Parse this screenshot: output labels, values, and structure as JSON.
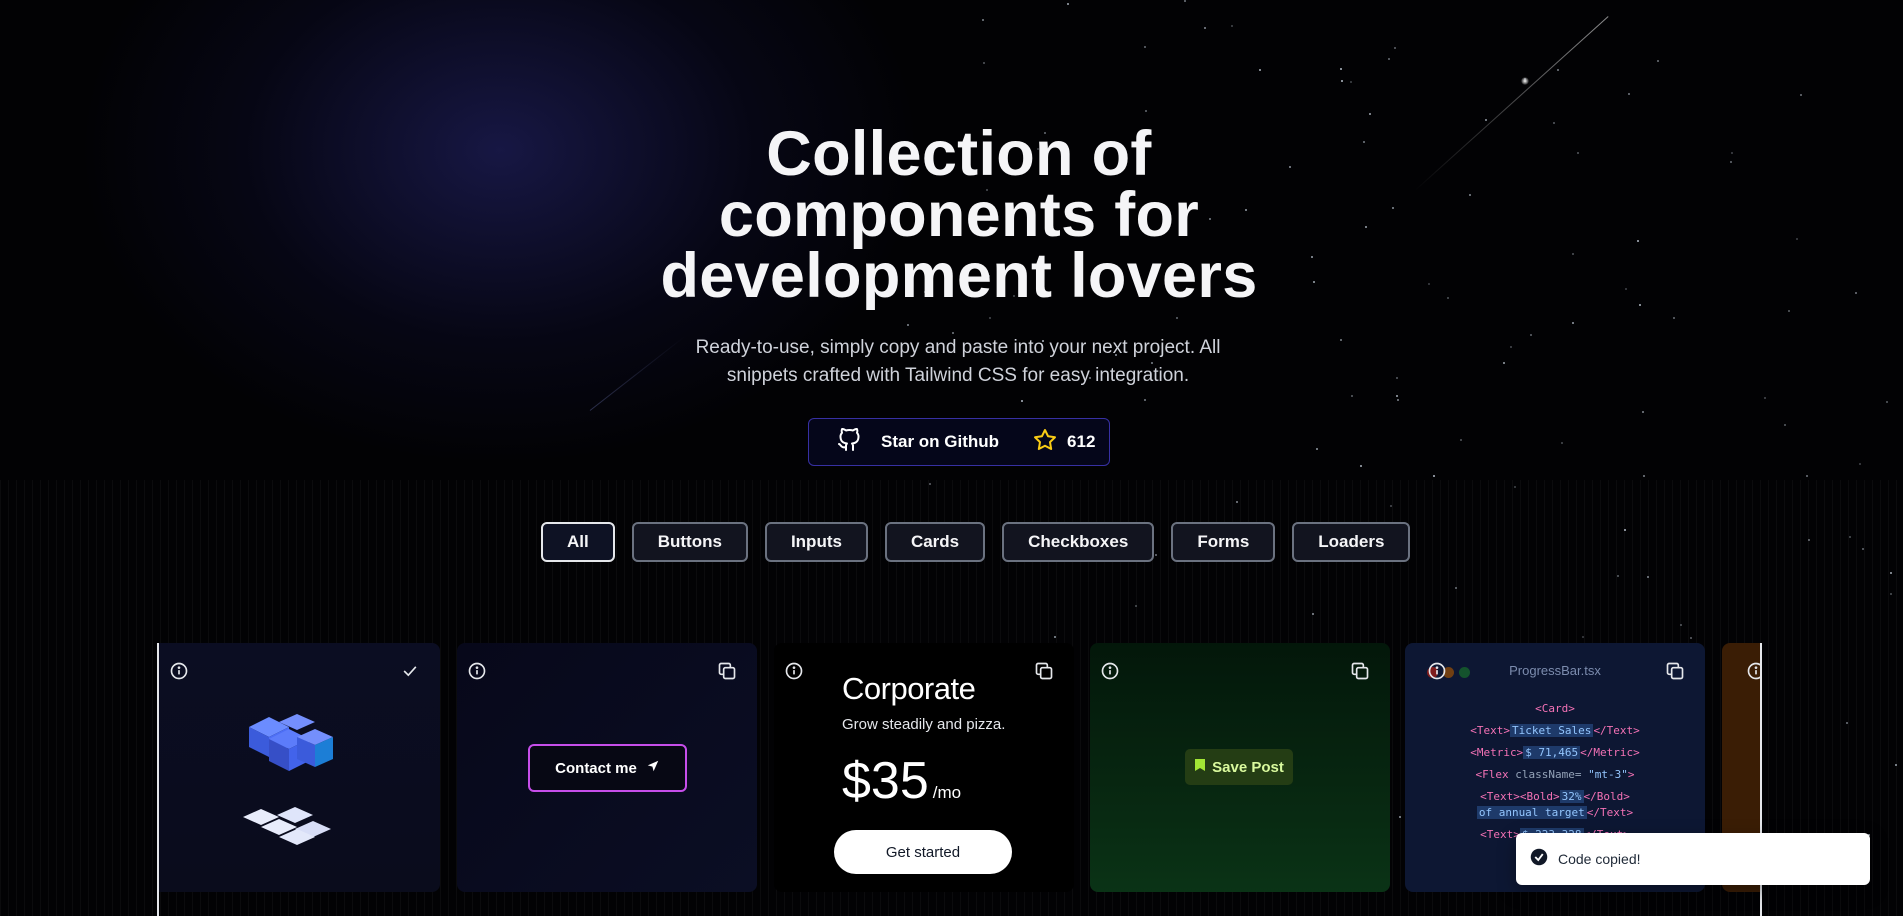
{
  "hero": {
    "title": "Collection of components for development lovers",
    "subtitle": "Ready-to-use, simply copy and paste into your next project. All snippets crafted with Tailwind CSS for easy integration.",
    "github_label": "Star on Github",
    "star_count": "612"
  },
  "filters": [
    {
      "label": "All",
      "active": true
    },
    {
      "label": "Buttons",
      "active": false
    },
    {
      "label": "Inputs",
      "active": false
    },
    {
      "label": "Cards",
      "active": false
    },
    {
      "label": "Checkboxes",
      "active": false
    },
    {
      "label": "Forms",
      "active": false
    },
    {
      "label": "Loaders",
      "active": false
    }
  ],
  "cards": {
    "contact": {
      "label": "Contact me"
    },
    "pricing": {
      "title": "Corporate",
      "subtitle": "Grow steadily and pizza.",
      "amount": "$35",
      "period": "/mo",
      "cta": "Get started"
    },
    "save": {
      "label": "Save Post"
    },
    "code": {
      "filename": "ProgressBar.tsx",
      "ticket_sales": "Ticket Sales",
      "metric": "$ 71,465",
      "class_attr": "className=",
      "class_value": "\"mt-3\"",
      "percent": "32%",
      "annual": "of annual target",
      "last_value": "$ 223,328"
    }
  },
  "toast": {
    "message": "Code copied!"
  },
  "colors": {
    "accent_border": "#3730a3",
    "contact_border": "#c64eea",
    "save_bg": "#243d14",
    "save_text": "#d9f99d",
    "star_color": "#facc15"
  }
}
